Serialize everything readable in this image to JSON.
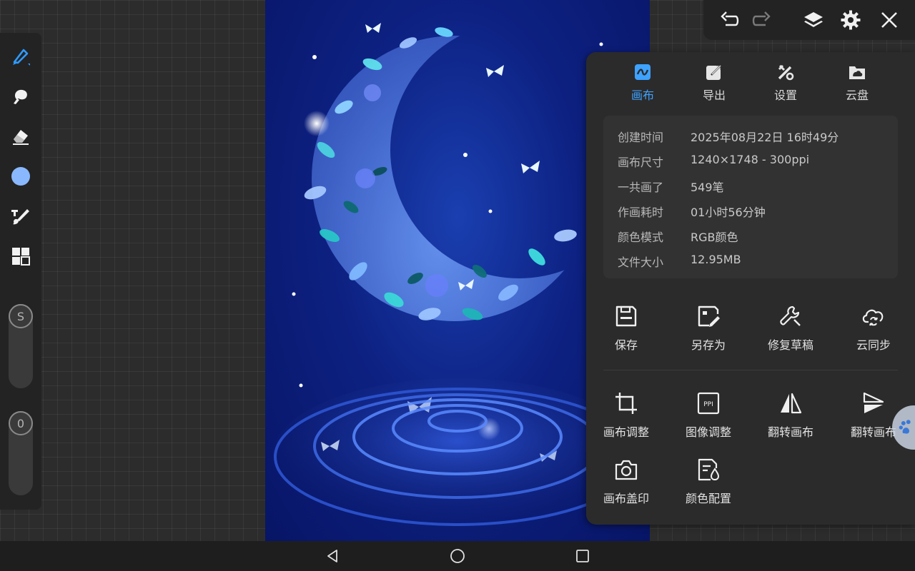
{
  "panel": {
    "tabs": [
      {
        "label": "画布",
        "icon": "canvas-tab-icon",
        "active": true
      },
      {
        "label": "导出",
        "icon": "export-icon",
        "active": false
      },
      {
        "label": "设置",
        "icon": "settings-tools-icon",
        "active": false
      },
      {
        "label": "云盘",
        "icon": "cloud-drive-icon",
        "active": false
      }
    ],
    "info": [
      {
        "label": "创建时间",
        "value": "2025年08月22日 16时49分"
      },
      {
        "label": "画布尺寸",
        "value": "1240×1748 - 300ppi"
      },
      {
        "label": "一共画了",
        "value": "549笔"
      },
      {
        "label": "作画耗时",
        "value": "01小时56分钟"
      },
      {
        "label": "颜色模式",
        "value": "RGB颜色"
      },
      {
        "label": "文件大小",
        "value": "12.95MB"
      }
    ],
    "actions_row1": [
      {
        "label": "保存",
        "icon": "save-icon"
      },
      {
        "label": "另存为",
        "icon": "save-as-icon"
      },
      {
        "label": "修复草稿",
        "icon": "wrench-icon"
      },
      {
        "label": "云同步",
        "icon": "cloud-sync-icon"
      }
    ],
    "actions_row2": [
      {
        "label": "画布调整",
        "icon": "crop-icon"
      },
      {
        "label": "图像调整",
        "icon": "ppi-icon"
      },
      {
        "label": "翻转画布",
        "icon": "flip-horizontal-icon"
      },
      {
        "label": "翻转画布",
        "icon": "flip-vertical-icon"
      }
    ],
    "actions_row3": [
      {
        "label": "画布盖印",
        "icon": "camera-stamp-icon"
      },
      {
        "label": "颜色配置",
        "icon": "color-profile-icon"
      }
    ]
  },
  "left_toolbar": {
    "tools": [
      "brush-icon",
      "smudge-icon",
      "eraser-icon",
      "color-swatch-icon",
      "adjust-brush-icon",
      "gallery-grid-icon"
    ],
    "size_slider_label": "S",
    "opacity_slider_label": "0"
  },
  "top_toolbar": {
    "buttons": [
      "undo-icon",
      "redo-icon",
      "layers-icon",
      "gear-icon",
      "close-icon"
    ]
  },
  "navbar": {
    "buttons": [
      "back-icon",
      "home-icon",
      "recents-icon"
    ]
  },
  "colors": {
    "accent": "#3ea2ff",
    "panel_bg": "#2b2b2b",
    "card_bg": "#323232",
    "toolbar_bg": "#232323",
    "current_brush_color": "#8ab8ff"
  }
}
